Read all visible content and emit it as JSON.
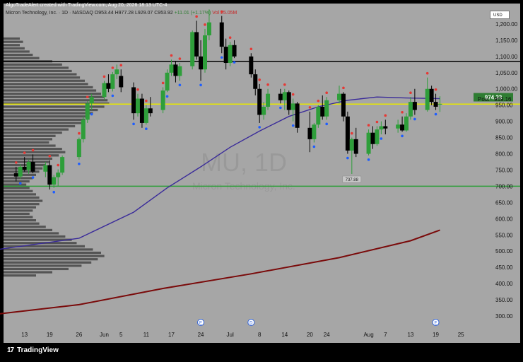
{
  "header": {
    "credit": "AlgoTradeAlert created with TradingView.com, Aug 20, 2026 18:13 UTC-4",
    "symbol": "Micron Technology, Inc. · 1D · NASDAQ",
    "ohlc_prefix": "O953.44 H977.28 L929.07 C953.92",
    "change": "+11.01 (+1.17%)",
    "vol": "Vol 25.05M",
    "currency": "USD",
    "brand": "TradingView"
  },
  "chart_data": {
    "type": "candlestick",
    "ylim": [
      300,
      1250
    ],
    "y_ticks": [
      300,
      350,
      400,
      450,
      500,
      550,
      600,
      650,
      700,
      750,
      800,
      850,
      900,
      950,
      1000,
      1050,
      1100,
      1150,
      1200
    ],
    "y_tick_labels": [
      "300.00",
      "350.00",
      "400.00",
      "450.00",
      "500.00",
      "550.00",
      "600.00",
      "650.00",
      "700.00",
      "750.00",
      "800.00",
      "850.00",
      "900.00",
      "950.00",
      "1,000.00",
      "1,050.00",
      "1,100.00",
      "1,150.00",
      "1,200.00"
    ],
    "x_ticks": [
      {
        "d": "2026-05-13",
        "label": "13"
      },
      {
        "d": "2026-05-19",
        "label": "19"
      },
      {
        "d": "2026-05-26",
        "label": "26"
      },
      {
        "d": "2026-06-01",
        "label": "Jun"
      },
      {
        "d": "2026-06-05",
        "label": "5"
      },
      {
        "d": "2026-06-11",
        "label": "11"
      },
      {
        "d": "2026-06-17",
        "label": "17"
      },
      {
        "d": "2026-06-24",
        "label": "24"
      },
      {
        "d": "2026-07-01",
        "label": "Jul"
      },
      {
        "d": "2026-07-08",
        "label": "8"
      },
      {
        "d": "2026-07-14",
        "label": "14"
      },
      {
        "d": "2026-07-20",
        "label": "20"
      },
      {
        "d": "2026-07-24",
        "label": "24"
      },
      {
        "d": "2026-08-03",
        "label": "Aug"
      },
      {
        "d": "2026-08-07",
        "label": "7"
      },
      {
        "d": "2026-08-13",
        "label": "13"
      },
      {
        "d": "2026-08-19",
        "label": "19"
      },
      {
        "d": "2026-08-25",
        "label": "25"
      }
    ],
    "candles": [
      [
        "2026-05-11",
        740,
        760,
        715,
        730
      ],
      [
        "2026-05-12",
        730,
        768,
        722,
        760
      ],
      [
        "2026-05-13",
        760,
        790,
        745,
        750
      ],
      [
        "2026-05-14",
        750,
        782,
        738,
        775
      ],
      [
        "2026-05-15",
        775,
        798,
        740,
        745
      ],
      [
        "2026-05-18",
        745,
        775,
        728,
        765
      ],
      [
        "2026-05-19",
        765,
        780,
        690,
        705
      ],
      [
        "2026-05-20",
        705,
        735,
        695,
        728
      ],
      [
        "2026-05-21",
        728,
        752,
        700,
        742
      ],
      [
        "2026-05-22",
        742,
        795,
        735,
        790
      ],
      [
        "2026-05-26",
        790,
        850,
        782,
        845
      ],
      [
        "2026-05-27",
        845,
        915,
        835,
        905
      ],
      [
        "2026-05-28",
        905,
        962,
        895,
        955
      ],
      [
        "2026-05-29",
        955,
        985,
        935,
        975
      ],
      [
        "2026-06-01",
        975,
        1025,
        965,
        1018
      ],
      [
        "2026-06-02",
        1018,
        1045,
        990,
        1000
      ],
      [
        "2026-06-03",
        1000,
        1052,
        992,
        1045
      ],
      [
        "2026-06-04",
        1045,
        1075,
        1030,
        1060
      ],
      [
        "2026-06-05",
        1040,
        1060,
        990,
        1005
      ],
      [
        "2026-06-08",
        1005,
        1020,
        905,
        925
      ],
      [
        "2026-06-09",
        925,
        985,
        915,
        970
      ],
      [
        "2026-06-10",
        970,
        985,
        880,
        895
      ],
      [
        "2026-06-11",
        895,
        950,
        890,
        940
      ],
      [
        "2026-06-12",
        940,
        975,
        915,
        925
      ],
      [
        "2026-06-15",
        935,
        1005,
        925,
        995
      ],
      [
        "2026-06-16",
        995,
        1060,
        990,
        1050
      ],
      [
        "2026-06-17",
        1050,
        1090,
        1040,
        1075
      ],
      [
        "2026-06-18",
        1075,
        1085,
        1020,
        1040
      ],
      [
        "2026-06-19",
        1040,
        1080,
        1025,
        1070
      ],
      [
        "2026-06-22",
        1070,
        1180,
        1060,
        1175
      ],
      [
        "2026-06-23",
        1175,
        1210,
        1090,
        1100
      ],
      [
        "2026-06-24",
        1100,
        1150,
        1025,
        1060
      ],
      [
        "2026-06-25",
        1060,
        1185,
        1050,
        1165
      ],
      [
        "2026-06-26",
        1165,
        1245,
        1150,
        1205
      ],
      [
        "2026-06-29",
        1205,
        1225,
        1110,
        1130
      ],
      [
        "2026-06-30",
        1130,
        1155,
        1060,
        1080
      ],
      [
        "2026-07-01",
        1080,
        1145,
        1070,
        1135
      ],
      [
        "2026-07-02",
        1135,
        1150,
        1095,
        1100
      ],
      [
        "2026-07-06",
        1100,
        1110,
        1035,
        1045
      ],
      [
        "2026-07-07",
        1045,
        1060,
        980,
        1000
      ],
      [
        "2026-07-08",
        1000,
        1015,
        895,
        920
      ],
      [
        "2026-07-09",
        920,
        960,
        905,
        945
      ],
      [
        "2026-07-10",
        945,
        1000,
        935,
        985
      ],
      [
        "2026-07-13",
        985,
        1000,
        955,
        965
      ],
      [
        "2026-07-14",
        965,
        1000,
        935,
        990
      ],
      [
        "2026-07-15",
        990,
        995,
        920,
        935
      ],
      [
        "2026-07-16",
        935,
        970,
        900,
        955
      ],
      [
        "2026-07-17",
        955,
        960,
        865,
        880
      ],
      [
        "2026-07-20",
        880,
        930,
        805,
        845
      ],
      [
        "2026-07-21",
        845,
        895,
        835,
        890
      ],
      [
        "2026-07-22",
        890,
        950,
        880,
        945
      ],
      [
        "2026-07-23",
        945,
        980,
        905,
        915
      ],
      [
        "2026-07-24",
        915,
        975,
        905,
        965
      ],
      [
        "2026-07-27",
        965,
        1010,
        955,
        985
      ],
      [
        "2026-07-28",
        985,
        990,
        900,
        915
      ],
      [
        "2026-07-29",
        915,
        930,
        800,
        810
      ],
      [
        "2026-07-30",
        810,
        850,
        737.88,
        845
      ],
      [
        "2026-07-31",
        845,
        880,
        790,
        800
      ],
      [
        "2026-08-03",
        800,
        875,
        795,
        865
      ],
      [
        "2026-08-04",
        865,
        885,
        815,
        830
      ],
      [
        "2026-08-05",
        830,
        885,
        825,
        875
      ],
      [
        "2026-08-06",
        875,
        900,
        860,
        885
      ],
      [
        "2026-08-07",
        885,
        905,
        860,
        878
      ],
      [
        "2026-08-10",
        878,
        905,
        865,
        890
      ],
      [
        "2026-08-11",
        890,
        915,
        868,
        872
      ],
      [
        "2026-08-12",
        872,
        925,
        868,
        915
      ],
      [
        "2026-08-13",
        915,
        975,
        905,
        960
      ],
      [
        "2026-08-14",
        960,
        1000,
        920,
        935
      ],
      [
        "2026-08-17",
        935,
        1035,
        930,
        1000
      ],
      [
        "2026-08-18",
        1000,
        1010,
        950,
        960
      ],
      [
        "2026-08-19",
        960,
        985,
        935,
        945
      ],
      [
        "2026-08-20",
        953.44,
        977.28,
        929.07,
        953.92
      ]
    ],
    "ma50": [
      [
        "2026-05-01",
        495
      ],
      [
        "2026-05-26",
        540
      ],
      [
        "2026-06-08",
        620
      ],
      [
        "2026-06-16",
        695
      ],
      [
        "2026-06-24",
        760
      ],
      [
        "2026-07-01",
        820
      ],
      [
        "2026-07-08",
        870
      ],
      [
        "2026-07-15",
        915
      ],
      [
        "2026-07-22",
        945
      ],
      [
        "2026-07-29",
        965
      ],
      [
        "2026-08-05",
        975
      ],
      [
        "2026-08-12",
        972
      ],
      [
        "2026-08-20",
        970
      ]
    ],
    "ma200": [
      [
        "2026-05-01",
        298
      ],
      [
        "2026-05-26",
        335
      ],
      [
        "2026-06-15",
        385
      ],
      [
        "2026-07-06",
        430
      ],
      [
        "2026-07-27",
        480
      ],
      [
        "2026-08-13",
        532
      ],
      [
        "2026-08-20",
        565
      ]
    ],
    "h_lines": [
      {
        "name": "resistance",
        "value": 1085,
        "color": "#000000"
      },
      {
        "name": "pivot",
        "value": 953,
        "color": "#e8e800"
      },
      {
        "name": "support",
        "value": 700,
        "color": "#2e9e3a"
      }
    ],
    "price_label": {
      "value": 974.33,
      "text": "974.33",
      "color": "#2e7d32"
    },
    "post_label": {
      "value": 969.16,
      "tag": "Post",
      "text": "969.16"
    },
    "low_label": {
      "value": 737.88,
      "text": "737.88"
    },
    "watermark": {
      "symbol": "MU, 1D",
      "name": "Micron Technology, Inc."
    },
    "volume_profile": [
      [
        1155,
        0.1
      ],
      [
        1145,
        0.12
      ],
      [
        1135,
        0.1
      ],
      [
        1125,
        0.13
      ],
      [
        1115,
        0.16
      ],
      [
        1105,
        0.18
      ],
      [
        1095,
        0.22
      ],
      [
        1085,
        0.3
      ],
      [
        1075,
        0.36
      ],
      [
        1065,
        0.4
      ],
      [
        1055,
        0.42
      ],
      [
        1045,
        0.45
      ],
      [
        1035,
        0.47
      ],
      [
        1025,
        0.5
      ],
      [
        1015,
        0.52
      ],
      [
        1005,
        0.55
      ],
      [
        995,
        0.57
      ],
      [
        985,
        0.6
      ],
      [
        975,
        0.62
      ],
      [
        965,
        0.64
      ],
      [
        955,
        0.65
      ],
      [
        945,
        0.62
      ],
      [
        935,
        0.58
      ],
      [
        925,
        0.55
      ],
      [
        915,
        0.52
      ],
      [
        905,
        0.5
      ],
      [
        895,
        0.48
      ],
      [
        885,
        0.44
      ],
      [
        875,
        0.4
      ],
      [
        865,
        0.36
      ],
      [
        855,
        0.32
      ],
      [
        845,
        0.3
      ],
      [
        835,
        0.28
      ],
      [
        825,
        0.32
      ],
      [
        815,
        0.36
      ],
      [
        805,
        0.38
      ],
      [
        795,
        0.34
      ],
      [
        785,
        0.3
      ],
      [
        775,
        0.28
      ],
      [
        765,
        0.26
      ],
      [
        755,
        0.24
      ],
      [
        745,
        0.22
      ],
      [
        735,
        0.2
      ],
      [
        725,
        0.18
      ],
      [
        715,
        0.16
      ],
      [
        705,
        0.14
      ],
      [
        695,
        0.16
      ],
      [
        685,
        0.18
      ],
      [
        675,
        0.2
      ],
      [
        665,
        0.22
      ],
      [
        655,
        0.24
      ],
      [
        645,
        0.22
      ],
      [
        635,
        0.2
      ],
      [
        625,
        0.18
      ],
      [
        615,
        0.16
      ],
      [
        605,
        0.18
      ],
      [
        595,
        0.2
      ],
      [
        585,
        0.22
      ],
      [
        575,
        0.26
      ],
      [
        565,
        0.3
      ],
      [
        555,
        0.34
      ],
      [
        545,
        0.38
      ],
      [
        535,
        0.42
      ],
      [
        525,
        0.45
      ],
      [
        515,
        0.5
      ],
      [
        505,
        0.55
      ],
      [
        495,
        0.6
      ],
      [
        485,
        0.62
      ],
      [
        475,
        0.58
      ],
      [
        465,
        0.54
      ],
      [
        455,
        0.48
      ],
      [
        445,
        0.4
      ],
      [
        435,
        0.3
      ],
      [
        425,
        0.2
      ]
    ],
    "events": [
      {
        "d": "2026-06-24",
        "label": "E"
      },
      {
        "d": "2026-07-06",
        "label": "D"
      },
      {
        "d": "2026-08-19",
        "label": "E"
      }
    ],
    "colors": {
      "up": "#2e9e3a",
      "down": "#000000",
      "ma50": "#3a2b9a",
      "ma200": "#7a0a0a",
      "marker_red": "#e53935",
      "marker_blue": "#1e5eff"
    }
  }
}
